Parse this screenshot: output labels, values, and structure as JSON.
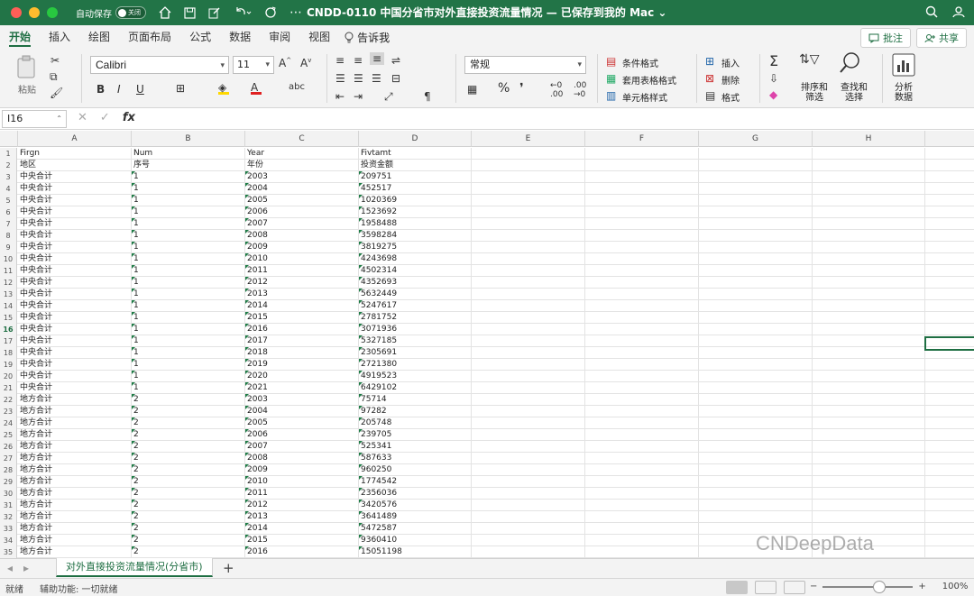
{
  "window": {
    "autosave_label": "自动保存",
    "autosave_state": "关闭",
    "title": "CNDD-0110 中国分省市对外直接投资流量情况 — 已保存到我的 Mac ⌄"
  },
  "ribbon_tabs": [
    "开始",
    "插入",
    "绘图",
    "页面布局",
    "公式",
    "数据",
    "审阅",
    "视图"
  ],
  "tell_me": "告诉我",
  "ribbon_actions": {
    "comment": "批注",
    "share": "共享"
  },
  "ribbon": {
    "paste": "粘贴",
    "font": "Calibri",
    "size": "11",
    "number_format": "常规",
    "conditional_format": "条件格式",
    "table_format": "套用表格格式",
    "cell_style": "单元格样式",
    "insert": "插入",
    "delete": "删除",
    "format": "格式",
    "sort_filter": "排序和\n筛选",
    "find_select": "查找和\n选择",
    "analyze": "分析\n数据"
  },
  "formula_bar": {
    "name_box": "I16",
    "fx": "fx",
    "value": ""
  },
  "columns": [
    "A",
    "B",
    "C",
    "D",
    "E",
    "F",
    "G",
    "H"
  ],
  "selected_row": 16,
  "rows": [
    [
      "Firgn",
      "Num",
      "Year",
      "Fivtamt"
    ],
    [
      "地区",
      "序号",
      "年份",
      "投资金额"
    ],
    [
      "中央合计",
      "1",
      "2003",
      "209751"
    ],
    [
      "中央合计",
      "1",
      "2004",
      "452517"
    ],
    [
      "中央合计",
      "1",
      "2005",
      "1020369"
    ],
    [
      "中央合计",
      "1",
      "2006",
      "1523692"
    ],
    [
      "中央合计",
      "1",
      "2007",
      "1958488"
    ],
    [
      "中央合计",
      "1",
      "2008",
      "3598284"
    ],
    [
      "中央合计",
      "1",
      "2009",
      "3819275"
    ],
    [
      "中央合计",
      "1",
      "2010",
      "4243698"
    ],
    [
      "中央合计",
      "1",
      "2011",
      "4502314"
    ],
    [
      "中央合计",
      "1",
      "2012",
      "4352693"
    ],
    [
      "中央合计",
      "1",
      "2013",
      "5632449"
    ],
    [
      "中央合计",
      "1",
      "2014",
      "5247617"
    ],
    [
      "中央合计",
      "1",
      "2015",
      "2781752"
    ],
    [
      "中央合计",
      "1",
      "2016",
      "3071936"
    ],
    [
      "中央合计",
      "1",
      "2017",
      "5327185"
    ],
    [
      "中央合计",
      "1",
      "2018",
      "2305691"
    ],
    [
      "中央合计",
      "1",
      "2019",
      "2721380"
    ],
    [
      "中央合计",
      "1",
      "2020",
      "4919523"
    ],
    [
      "中央合计",
      "1",
      "2021",
      "6429102"
    ],
    [
      "地方合计",
      "2",
      "2003",
      "75714"
    ],
    [
      "地方合计",
      "2",
      "2004",
      "97282"
    ],
    [
      "地方合计",
      "2",
      "2005",
      "205748"
    ],
    [
      "地方合计",
      "2",
      "2006",
      "239705"
    ],
    [
      "地方合计",
      "2",
      "2007",
      "525341"
    ],
    [
      "地方合计",
      "2",
      "2008",
      "587633"
    ],
    [
      "地方合计",
      "2",
      "2009",
      "960250"
    ],
    [
      "地方合计",
      "2",
      "2010",
      "1774542"
    ],
    [
      "地方合计",
      "2",
      "2011",
      "2356036"
    ],
    [
      "地方合计",
      "2",
      "2012",
      "3420576"
    ],
    [
      "地方合计",
      "2",
      "2013",
      "3641489"
    ],
    [
      "地方合计",
      "2",
      "2014",
      "5472587"
    ],
    [
      "地方合计",
      "2",
      "2015",
      "9360410"
    ],
    [
      "地方合计",
      "2",
      "2016",
      "15051198"
    ]
  ],
  "sheet_tab": "对外直接投资流量情况(分省市)",
  "status": {
    "ready": "就绪",
    "accessibility": "辅助功能: 一切就绪",
    "zoom": "100%"
  },
  "watermark": "CNDeepData",
  "colors": {
    "accent": "#227447",
    "triangle": "#1e7b45"
  }
}
